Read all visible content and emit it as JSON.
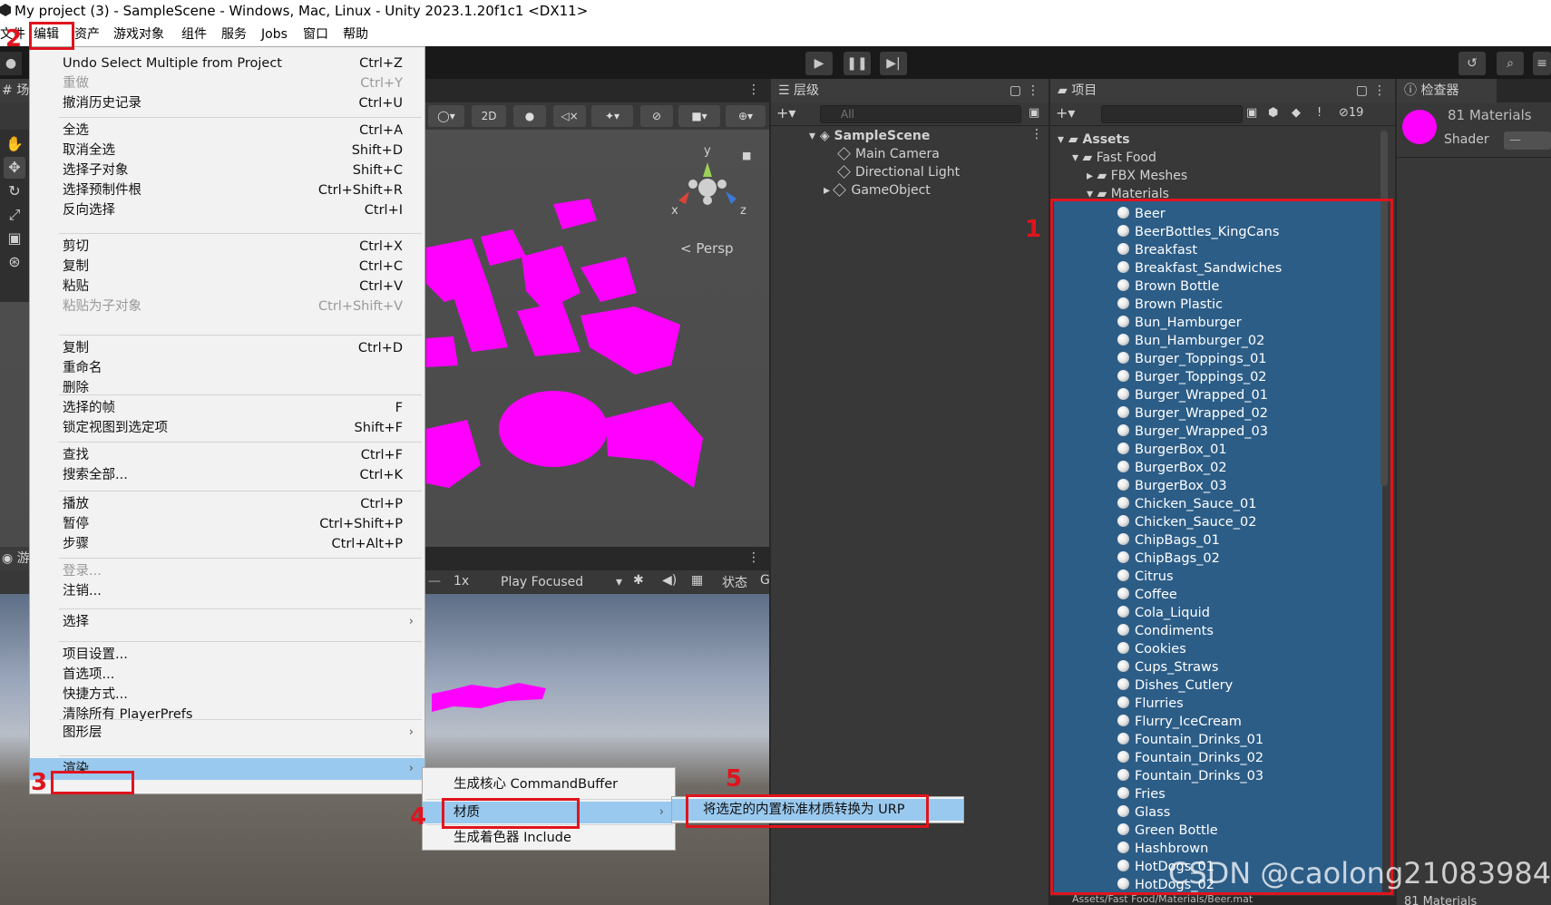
{
  "window": {
    "title": "My project (3) - SampleScene - Windows, Mac, Linux - Unity 2023.1.20f1c1 <DX11>"
  },
  "menubar": {
    "items": [
      "文件",
      "编辑",
      "资产",
      "游戏对象",
      "组件",
      "服务",
      "Jobs",
      "窗口",
      "帮助"
    ]
  },
  "toolbar": {
    "play_icon": "play-icon",
    "pause_icon": "pause-icon",
    "step_icon": "step-icon"
  },
  "scene": {
    "tab_label": "场",
    "mode_2d": "2D",
    "persp_label": "< Persp",
    "gizmo_x": "x",
    "gizmo_y": "y",
    "gizmo_z": "z"
  },
  "game": {
    "tab_label": "游",
    "scale": "1x",
    "play_mode": "Play Focused",
    "stats_label": "状态",
    "gizmos_label": "G"
  },
  "hierarchy": {
    "tab_label": "层级",
    "search_placeholder": "All",
    "scene_name": "SampleScene",
    "objects": [
      "Main Camera",
      "Directional Light",
      "GameObject"
    ]
  },
  "project": {
    "tab_label": "项目",
    "hidden_count": "19",
    "tree": {
      "root": "Assets",
      "folder": "Fast Food",
      "subfolders": [
        "FBX Meshes",
        "Materials"
      ]
    },
    "materials": [
      "Beer",
      "BeerBottles_KingCans",
      "Breakfast",
      "Breakfast_Sandwiches",
      "Brown Bottle",
      "Brown Plastic",
      "Bun_Hamburger",
      "Bun_Hamburger_02",
      "Burger_Toppings_01",
      "Burger_Toppings_02",
      "Burger_Wrapped_01",
      "Burger_Wrapped_02",
      "Burger_Wrapped_03",
      "BurgerBox_01",
      "BurgerBox_02",
      "BurgerBox_03",
      "Chicken_Sauce_01",
      "Chicken_Sauce_02",
      "ChipBags_01",
      "ChipBags_02",
      "Citrus",
      "Coffee",
      "Cola_Liquid",
      "Condiments",
      "Cookies",
      "Cups_Straws",
      "Dishes_Cutlery",
      "Flurries",
      "Flurry_IceCream",
      "Fountain_Drinks_01",
      "Fountain_Drinks_02",
      "Fountain_Drinks_03",
      "Fries",
      "Glass",
      "Green Bottle",
      "Hashbrown",
      "HotDogs_01",
      "HotDogs_02"
    ],
    "path": "Assets/Fast Food/Materials/Beer.mat"
  },
  "inspector": {
    "tab_label": "检查器",
    "title": "81 Materials",
    "shader_label": "Shader",
    "shader_value": "—",
    "footer": "81 Materials",
    "swatch_color": "#ff00ff"
  },
  "edit_menu": {
    "groups": [
      [
        {
          "label": "Undo Select Multiple from Project",
          "shortcut": "Ctrl+Z"
        },
        {
          "label": "重做",
          "shortcut": "Ctrl+Y",
          "disabled": true
        },
        {
          "label": "撤消历史记录",
          "shortcut": "Ctrl+U"
        }
      ],
      [
        {
          "label": "全选",
          "shortcut": "Ctrl+A"
        },
        {
          "label": "取消全选",
          "shortcut": "Shift+D"
        },
        {
          "label": "选择子对象",
          "shortcut": "Shift+C"
        },
        {
          "label": "选择预制件根",
          "shortcut": "Ctrl+Shift+R"
        },
        {
          "label": "反向选择",
          "shortcut": "Ctrl+I"
        }
      ],
      [
        {
          "label": "剪切",
          "shortcut": "Ctrl+X"
        },
        {
          "label": "复制",
          "shortcut": "Ctrl+C"
        },
        {
          "label": "粘贴",
          "shortcut": "Ctrl+V"
        },
        {
          "label": "粘贴为子对象",
          "shortcut": "Ctrl+Shift+V",
          "disabled": true
        }
      ],
      [
        {
          "label": "复制",
          "shortcut": "Ctrl+D"
        },
        {
          "label": "重命名",
          "shortcut": ""
        },
        {
          "label": "删除",
          "shortcut": ""
        }
      ],
      [
        {
          "label": "选择的帧",
          "shortcut": "F"
        },
        {
          "label": "锁定视图到选定项",
          "shortcut": "Shift+F"
        }
      ],
      [
        {
          "label": "查找",
          "shortcut": "Ctrl+F"
        },
        {
          "label": "搜索全部...",
          "shortcut": "Ctrl+K"
        }
      ],
      [
        {
          "label": "播放",
          "shortcut": "Ctrl+P"
        },
        {
          "label": "暂停",
          "shortcut": "Ctrl+Shift+P"
        },
        {
          "label": "步骤",
          "shortcut": "Ctrl+Alt+P"
        }
      ],
      [
        {
          "label": "登录...",
          "shortcut": "",
          "disabled": true
        },
        {
          "label": "注销...",
          "shortcut": ""
        }
      ],
      [
        {
          "label": "选择",
          "shortcut": "",
          "submenu": true
        }
      ],
      [
        {
          "label": "项目设置...",
          "shortcut": ""
        },
        {
          "label": "首选项...",
          "shortcut": ""
        },
        {
          "label": "快捷方式...",
          "shortcut": ""
        },
        {
          "label": "清除所有 PlayerPrefs",
          "shortcut": ""
        }
      ],
      [
        {
          "label": "图形层",
          "shortcut": "",
          "submenu": true
        }
      ],
      [
        {
          "label": "渲染",
          "shortcut": "",
          "submenu": true,
          "highlighted": true
        }
      ]
    ]
  },
  "render_submenu": {
    "items": [
      {
        "label": "生成核心 CommandBuffer",
        "submenu": false
      },
      {
        "label": "材质",
        "submenu": true,
        "highlighted": true
      },
      {
        "label": "生成着色器 Include",
        "submenu": false
      }
    ]
  },
  "material_submenu": {
    "items": [
      {
        "label": "将选定的内置标准材质转换为 URP",
        "highlighted": true
      }
    ]
  },
  "annotations": {
    "numbers": [
      "1",
      "2",
      "3",
      "4",
      "5"
    ],
    "color": "#e0141d"
  },
  "watermark": "CSDN @caolong210839842"
}
